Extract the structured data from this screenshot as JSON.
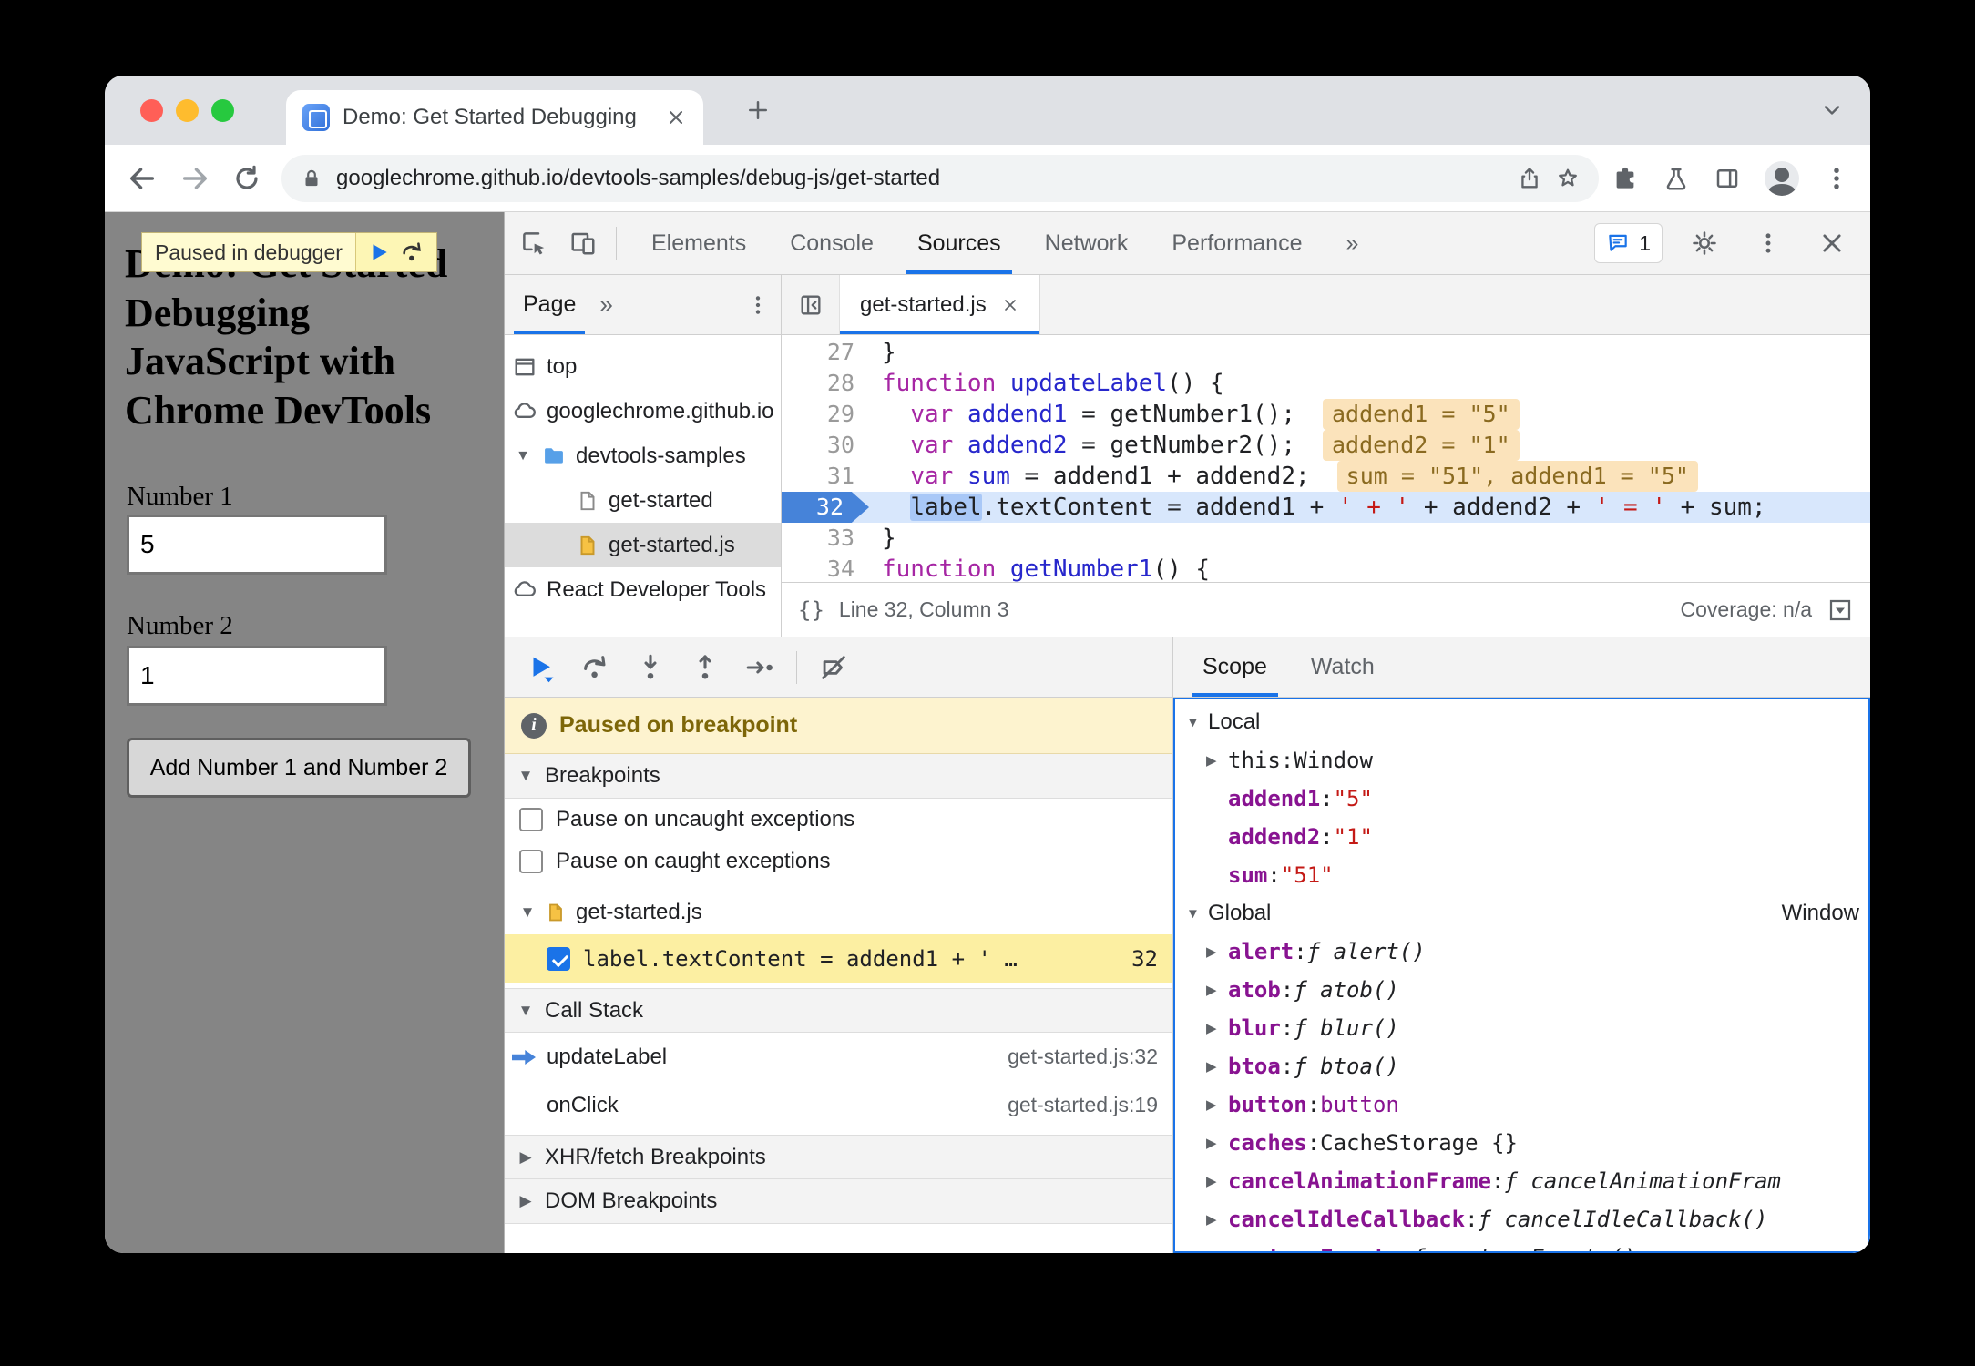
{
  "browser": {
    "tab_title": "Demo: Get Started Debugging",
    "url": "googlechrome.github.io/devtools-samples/debug-js/get-started"
  },
  "page": {
    "paused_overlay": "Paused in debugger",
    "heading": "Demo: Get Started Debugging JavaScript with Chrome DevTools",
    "number1_label": "Number 1",
    "number1_value": "5",
    "number2_label": "Number 2",
    "number2_value": "1",
    "add_button": "Add Number 1 and Number 2"
  },
  "devtools": {
    "tabs": [
      "Elements",
      "Console",
      "Sources",
      "Network",
      "Performance"
    ],
    "overflow": "»",
    "issues_count": "1"
  },
  "navigator": {
    "tab": "Page",
    "overflow": "»",
    "items": [
      {
        "label": "top"
      },
      {
        "label": "googlechrome.github.io"
      },
      {
        "label": "devtools-samples"
      },
      {
        "label": "get-started"
      },
      {
        "label": "get-started.js"
      },
      {
        "label": "React Developer Tools"
      }
    ]
  },
  "editor": {
    "file_tab": "get-started.js",
    "braces": "{}",
    "status_line": "Line 32, Column 3",
    "coverage": "Coverage: n/a",
    "lines": [
      {
        "num": "27",
        "segs": [
          {
            "t": "}"
          }
        ]
      },
      {
        "num": "28",
        "segs": [
          {
            "t": "function"
          },
          {
            "t": " "
          },
          {
            "t": "updateLabel"
          },
          {
            "t": "() {"
          }
        ]
      },
      {
        "num": "29",
        "segs": [
          {
            "t": "  "
          },
          {
            "t": "var"
          },
          {
            "t": " "
          },
          {
            "t": "addend1"
          },
          {
            "t": " = getNumber1();"
          }
        ],
        "eval": "addend1 = \"5\""
      },
      {
        "num": "30",
        "segs": [
          {
            "t": "  "
          },
          {
            "t": "var"
          },
          {
            "t": " "
          },
          {
            "t": "addend2"
          },
          {
            "t": " = getNumber2();"
          }
        ],
        "eval": "addend2 = \"1\""
      },
      {
        "num": "31",
        "segs": [
          {
            "t": "  "
          },
          {
            "t": "var"
          },
          {
            "t": " "
          },
          {
            "t": "sum"
          },
          {
            "t": " = addend1 + addend2;"
          }
        ],
        "eval": "sum = \"51\", addend1 = \"5\""
      },
      {
        "num": "32",
        "segs": [
          {
            "t": "  "
          },
          {
            "t": "label"
          },
          {
            "t": ".textContent = addend1 + "
          },
          {
            "t": "' + '"
          },
          {
            "t": " + addend2 + "
          },
          {
            "t": "' = '"
          },
          {
            "t": " + sum;"
          }
        ]
      },
      {
        "num": "33",
        "segs": [
          {
            "t": "}"
          }
        ]
      },
      {
        "num": "34",
        "segs": [
          {
            "t": "function"
          },
          {
            "t": " "
          },
          {
            "t": "getNumber1"
          },
          {
            "t": "() {"
          }
        ]
      }
    ]
  },
  "debugger": {
    "paused_message": "Paused on breakpoint",
    "breakpoints_title": "Breakpoints",
    "pause_uncaught": "Pause on uncaught exceptions",
    "pause_caught": "Pause on caught exceptions",
    "bp_file": "get-started.js",
    "bp_code": "label.textContent = addend1 + ' …",
    "bp_line": "32",
    "callstack_title": "Call Stack",
    "frames": [
      {
        "name": "updateLabel",
        "loc": "get-started.js:32"
      },
      {
        "name": "onClick",
        "loc": "get-started.js:19"
      }
    ],
    "xhr_title": "XHR/fetch Breakpoints",
    "dom_title": "DOM Breakpoints"
  },
  "scope": {
    "tabs": [
      "Scope",
      "Watch"
    ],
    "local_title": "Local",
    "global_title": "Global",
    "global_value": "Window",
    "local_props": [
      {
        "name": "this",
        "sep": ": ",
        "value": "Window"
      },
      {
        "name": "addend1",
        "sep": ": ",
        "value": "\"5\""
      },
      {
        "name": "addend2",
        "sep": ": ",
        "value": "\"1\""
      },
      {
        "name": "sum",
        "sep": ": ",
        "value": "\"51\""
      }
    ],
    "global_props": [
      {
        "name": "alert",
        "sep": ": ",
        "value": "ƒ alert()"
      },
      {
        "name": "atob",
        "sep": ": ",
        "value": "ƒ atob()"
      },
      {
        "name": "blur",
        "sep": ": ",
        "value": "ƒ blur()"
      },
      {
        "name": "btoa",
        "sep": ": ",
        "value": "ƒ btoa()"
      },
      {
        "name": "button",
        "sep": ": ",
        "value": "button"
      },
      {
        "name": "caches",
        "sep": ": ",
        "value": "CacheStorage {}"
      },
      {
        "name": "canc­elAnimationFrame",
        "sep": ": ",
        "value": "ƒ cancelAnimationFram"
      },
      {
        "name": "cancelIdleCallback",
        "sep": ": ",
        "value": "ƒ cancelIdleCallback()"
      },
      {
        "name": "captureEvents",
        "sep": ": ",
        "value": "ƒ captureEvents()"
      }
    ]
  }
}
